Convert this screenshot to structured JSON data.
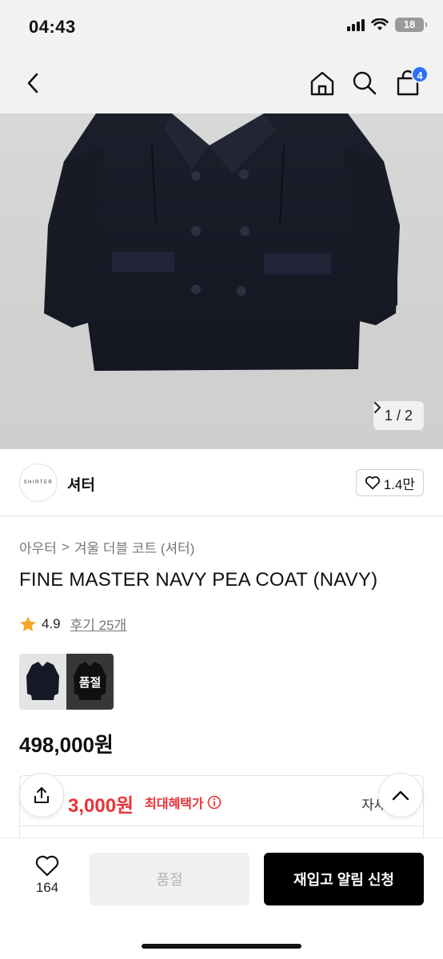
{
  "status_bar": {
    "time": "04:43",
    "battery": "18"
  },
  "header": {
    "cart_count": "4"
  },
  "gallery": {
    "current": "1",
    "separator": "/",
    "total": "2"
  },
  "brand": {
    "logo_text": "SHIRTER",
    "name": "셔터",
    "like_count": "1.4만"
  },
  "breadcrumb": {
    "category": "아우터",
    "separator": ">",
    "subcategory": "겨울 더블 코트 (셔터)"
  },
  "product": {
    "title": "FINE MASTER NAVY PEA COAT (NAVY)",
    "rating": "4.9",
    "reviews": "후기 25개",
    "sold_out_badge": "품절",
    "price": "498,000원"
  },
  "benefit": {
    "price": "3,000원",
    "label": "최대혜택가",
    "detail": "자세히"
  },
  "bottom_bar": {
    "wish_count": "164",
    "soldout_label": "품절",
    "restock_label": "재입고 알림 신청"
  },
  "colors": {
    "accent_red": "#e8333a",
    "badge_blue": "#2f6ff6",
    "star": "#f5a623"
  },
  "icons": [
    "back-arrow-icon",
    "home-icon",
    "search-icon",
    "cart-icon",
    "chevron-right-icon",
    "heart-icon",
    "star-icon",
    "info-icon",
    "share-icon",
    "chevron-up-icon"
  ]
}
